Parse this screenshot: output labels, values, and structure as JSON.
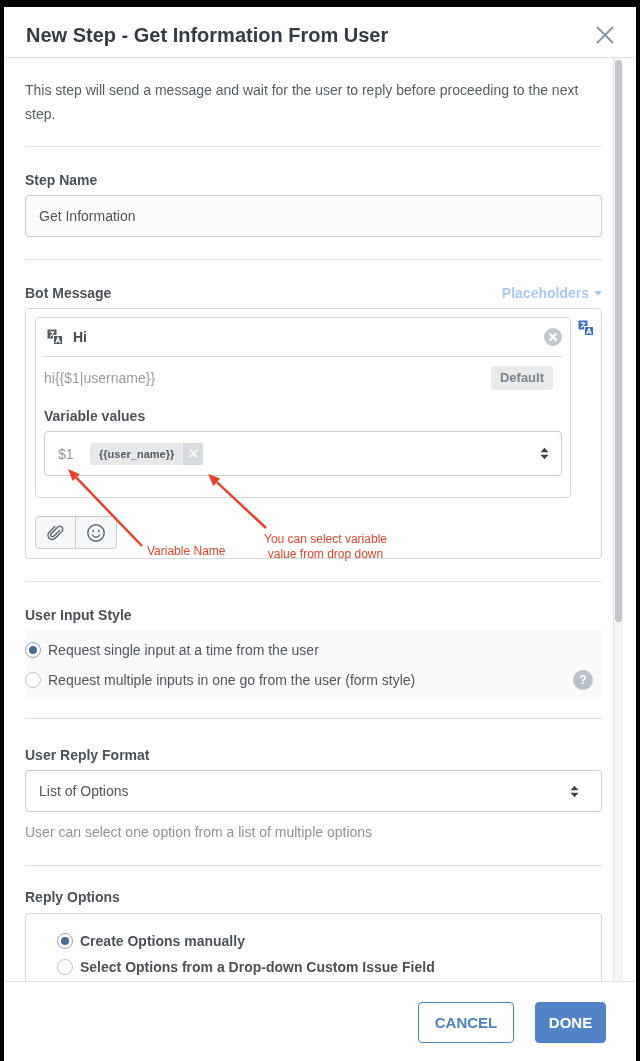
{
  "dialog": {
    "title": "New Step - Get Information From User"
  },
  "description": "This step will send a message and wait for the user to reply before proceeding to the next step.",
  "step_name": {
    "label": "Step Name",
    "value": "Get Information"
  },
  "bot_message": {
    "label": "Bot Message",
    "placeholders_link": "Placeholders",
    "message": {
      "text": "Hi",
      "template": "hi{{$1|username}}",
      "badge": "Default",
      "variables_label": "Variable values",
      "variables": [
        {
          "name": "$1",
          "tags": [
            "{{user_name}}"
          ]
        }
      ]
    },
    "annotations": [
      {
        "lines": [
          "Variable Name"
        ]
      },
      {
        "lines": [
          "You can select variable",
          "value from drop down"
        ]
      }
    ]
  },
  "user_input_style": {
    "label": "User Input Style",
    "options": [
      {
        "label": "Request single input at a time from the user",
        "selected": true
      },
      {
        "label": "Request multiple inputs in one go from the user (form style)",
        "selected": false
      }
    ],
    "help": "?"
  },
  "user_reply_format": {
    "label": "User Reply Format",
    "value": "List of Options",
    "hint": "User can select one option from a list of multiple options"
  },
  "reply_options": {
    "label": "Reply Options",
    "options": [
      {
        "label": "Create Options manually",
        "selected": true
      },
      {
        "label": "Select Options from a Drop-down Custom Issue Field",
        "selected": false
      }
    ]
  },
  "buttons": [
    {
      "label": "CANCEL",
      "kind": "secondary"
    },
    {
      "label": "DONE",
      "kind": "primary"
    }
  ]
}
